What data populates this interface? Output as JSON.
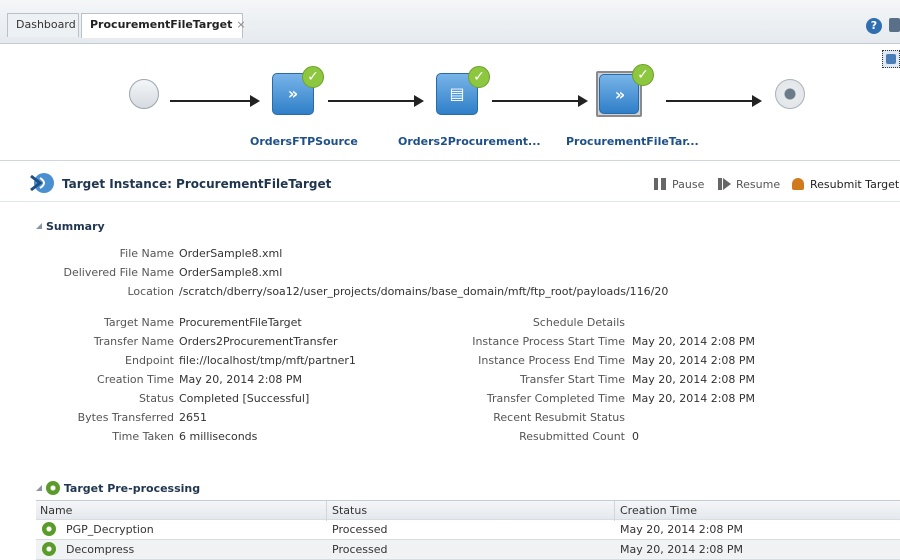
{
  "tabs": [
    {
      "label": "Dashboard"
    },
    {
      "label": "ProcurementFileTarget",
      "close": "×"
    }
  ],
  "header_icons": {
    "help": "?"
  },
  "flow": {
    "nodes": [
      {
        "label": "OrdersFTPSource",
        "icon": "source-icon"
      },
      {
        "label": "Orders2Procurement...",
        "icon": "transfer-icon"
      },
      {
        "label": "ProcurementFileTar...",
        "icon": "target-icon"
      }
    ],
    "check_glyph": "✓"
  },
  "instance": {
    "title": "Target Instance: ProcurementFileTarget",
    "actions": {
      "pause": "Pause",
      "resume": "Resume",
      "resubmit": "Resubmit Target"
    }
  },
  "summary": {
    "header": "Summary",
    "file_fields": [
      {
        "label": "File Name",
        "value": "OrderSample8.xml"
      },
      {
        "label": "Delivered File Name",
        "value": "OrderSample8.xml"
      },
      {
        "label": "Location",
        "value": "/scratch/dberry/soa12/user_projects/domains/base_domain/mft/ftp_root/payloads/116/20"
      }
    ],
    "left_fields": [
      {
        "label": "Target Name",
        "value": "ProcurementFileTarget"
      },
      {
        "label": "Transfer Name",
        "value": "Orders2ProcurementTransfer"
      },
      {
        "label": "Endpoint",
        "value": "file://localhost/tmp/mft/partner1"
      },
      {
        "label": "Creation Time",
        "value": "May 20, 2014 2:08 PM"
      },
      {
        "label": "Status",
        "value": "Completed [Successful]"
      },
      {
        "label": "Bytes Transferred",
        "value": "2651"
      },
      {
        "label": "Time Taken",
        "value": "6 milliseconds"
      }
    ],
    "right_fields": [
      {
        "label": "Schedule Details",
        "value": ""
      },
      {
        "label": "Instance Process Start Time",
        "value": "May 20, 2014 2:08 PM"
      },
      {
        "label": "Instance Process End Time",
        "value": "May 20, 2014 2:08 PM"
      },
      {
        "label": "Transfer Start Time",
        "value": "May 20, 2014 2:08 PM"
      },
      {
        "label": "Transfer Completed Time",
        "value": "May 20, 2014 2:08 PM"
      },
      {
        "label": "Recent Resubmit Status",
        "value": ""
      },
      {
        "label": "Resubmitted Count",
        "value": "0"
      }
    ]
  },
  "preprocessing": {
    "header": "Target Pre-processing",
    "columns": [
      "Name",
      "Status",
      "Creation Time"
    ],
    "rows": [
      {
        "name": "PGP_Decryption",
        "status": "Processed",
        "created": "May 20, 2014 2:08 PM"
      },
      {
        "name": "Decompress",
        "status": "Processed",
        "created": "May 20, 2014 2:08 PM"
      }
    ]
  }
}
